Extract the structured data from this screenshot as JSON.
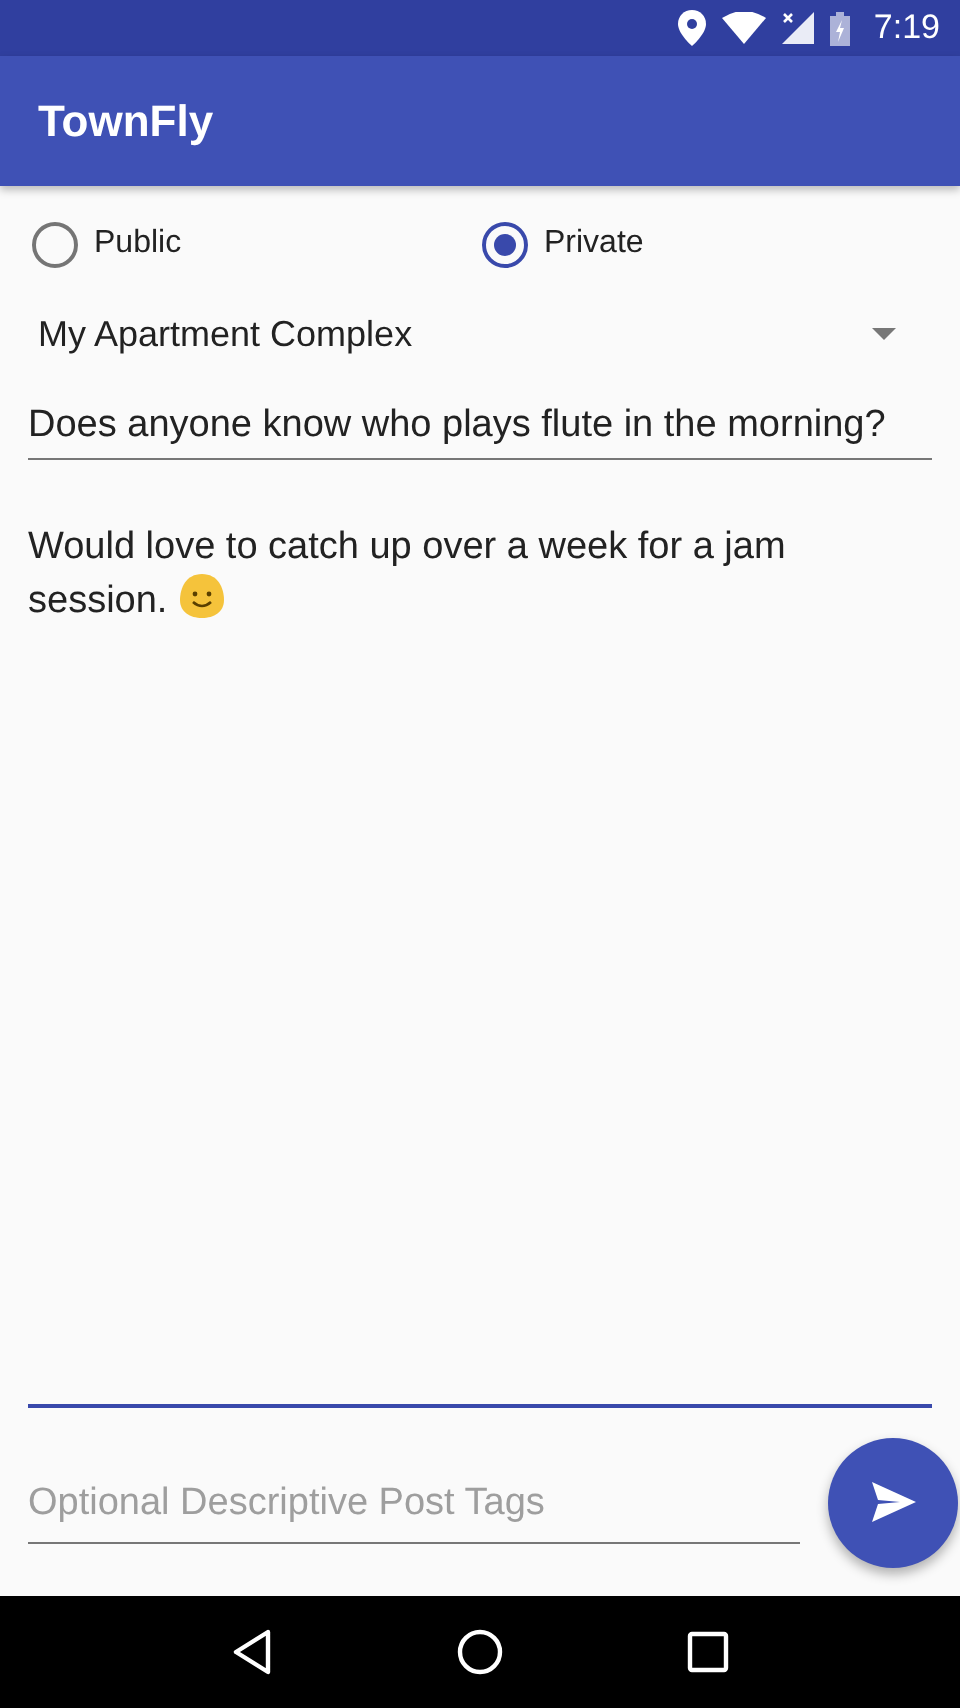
{
  "status_bar": {
    "time": "7:19"
  },
  "app_bar": {
    "title": "TownFly"
  },
  "visibility": [
    {
      "label": "Public",
      "selected": false
    },
    {
      "label": "Private",
      "selected": true
    }
  ],
  "audience_dropdown": {
    "value": "My Apartment Complex"
  },
  "title_field": {
    "value": "Does anyone know who plays flute in the morning?"
  },
  "body_field": {
    "value": "Would love to catch up over a week for a jam session."
  },
  "tags_field": {
    "placeholder": "Optional Descriptive Post Tags"
  }
}
